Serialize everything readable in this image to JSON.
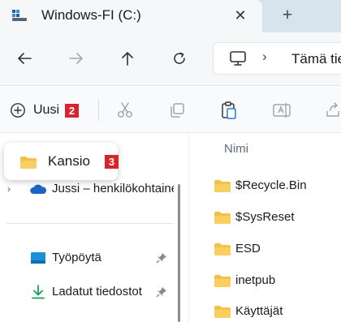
{
  "tabs": {
    "active_title": "Windows-FI (C:)",
    "close_icon": "close-icon",
    "new_tab_icon": "plus-icon"
  },
  "address": {
    "separator": "›",
    "path_text": "Tämä tie"
  },
  "command_bar": {
    "new_label": "Uusi",
    "new_badge": "2",
    "icons": [
      "cut-icon",
      "copy-icon",
      "paste-icon",
      "rename-icon",
      "share-icon"
    ]
  },
  "popup": {
    "label": "Kansio",
    "badge": "3"
  },
  "nav_pane": {
    "onedrive_label": "Jussi – henkilökohtainen",
    "quick_access": [
      {
        "label": "Työpöytä",
        "icon": "desktop-icon"
      },
      {
        "label": "Ladatut tiedostot",
        "icon": "download-icon"
      }
    ]
  },
  "file_list": {
    "column_name": "Nimi",
    "items": [
      "$Recycle.Bin",
      "$SysReset",
      "ESD",
      "inetpub",
      "Käyttäjät"
    ]
  },
  "colors": {
    "badge": "#d6252d",
    "folder": "#f4c045",
    "tabbar": "#d7e4ee"
  }
}
